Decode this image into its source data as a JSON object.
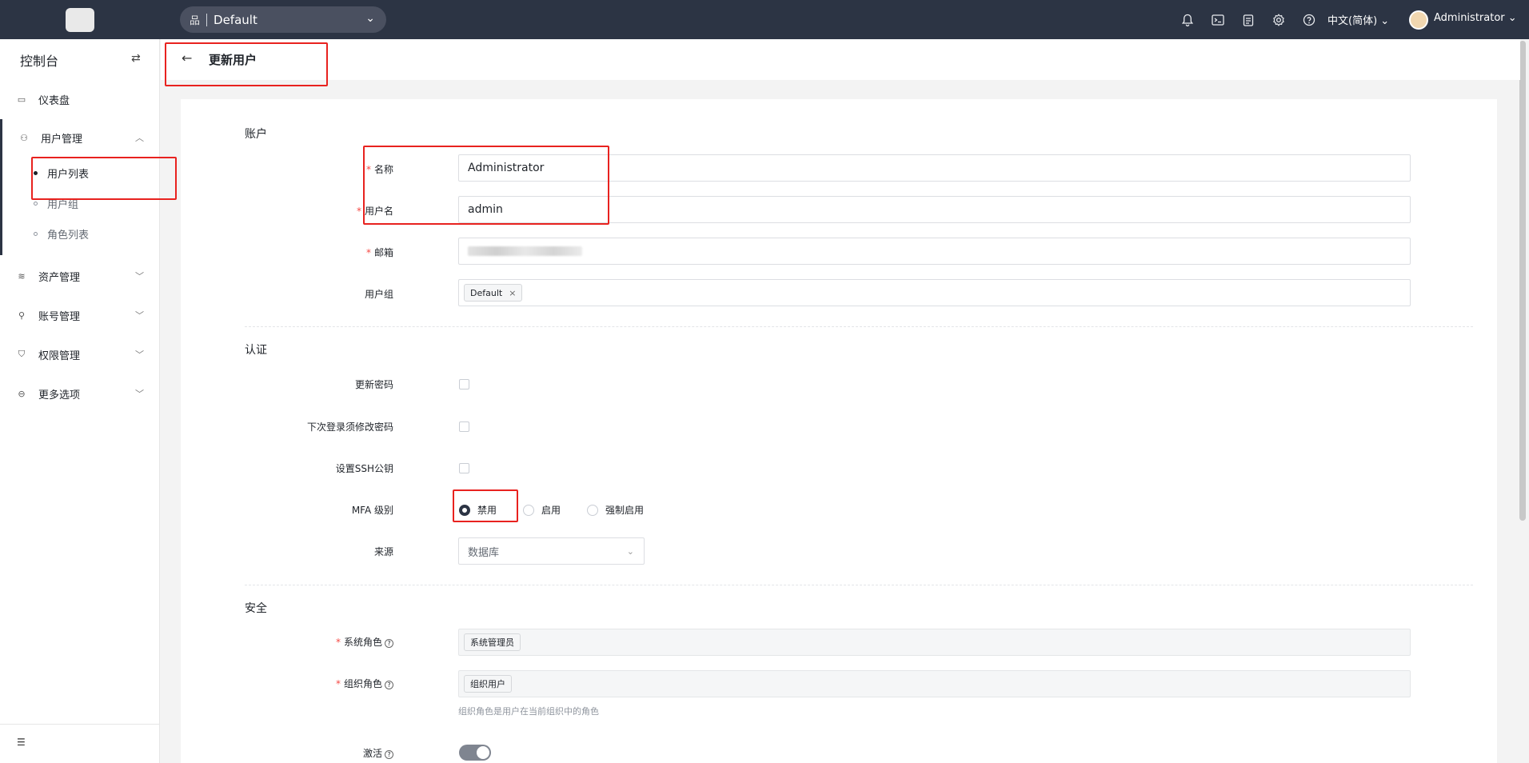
{
  "topbar": {
    "org": "Default",
    "lang": "中文(简体)",
    "user": "Administrator",
    "icons": [
      "bell-icon",
      "terminal-icon",
      "clipboard-icon",
      "gear-icon",
      "help-icon"
    ]
  },
  "sidebar": {
    "title": "控制台",
    "items": [
      {
        "label": "仪表盘",
        "icon": "dashboard-icon"
      },
      {
        "label": "用户管理",
        "icon": "users-icon"
      },
      {
        "label": "资产管理",
        "icon": "layers-icon"
      },
      {
        "label": "账号管理",
        "icon": "account-icon"
      },
      {
        "label": "权限管理",
        "icon": "shield-icon"
      },
      {
        "label": "更多选项",
        "icon": "more-icon"
      }
    ],
    "subitems": [
      "用户列表",
      "用户组",
      "角色列表"
    ]
  },
  "page": {
    "title": "更新用户"
  },
  "form": {
    "section_account": "账户",
    "name_label": "名称",
    "name_value": "Administrator",
    "username_label": "用户名",
    "username_value": "admin",
    "email_label": "邮箱",
    "group_label": "用户组",
    "group_tag": "Default",
    "section_auth": "认证",
    "update_pwd_label": "更新密码",
    "must_change_label": "下次登录须修改密码",
    "ssh_label": "设置SSH公钥",
    "mfa_label": "MFA 级别",
    "mfa_options": [
      "禁用",
      "启用",
      "强制启用"
    ],
    "mfa_selected": "禁用",
    "source_label": "来源",
    "source_value": "数据库",
    "section_security": "安全",
    "sys_role_label": "系统角色",
    "sys_role_tag": "系统管理员",
    "org_role_label": "组织角色",
    "org_role_tag": "组织用户",
    "org_role_hint": "组织角色是用户在当前组织中的角色",
    "active_label": "激活",
    "active_on": true
  }
}
